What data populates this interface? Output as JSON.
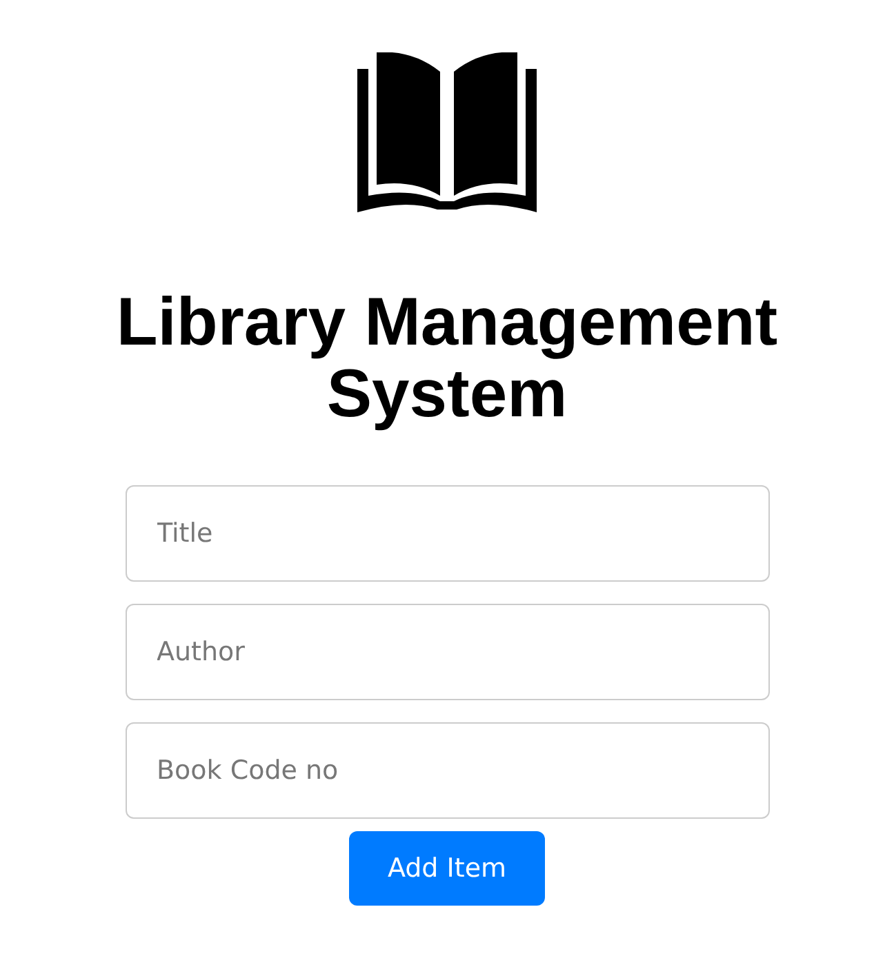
{
  "title": "Library Management System",
  "fields": [
    {
      "placeholder": "Title"
    },
    {
      "placeholder": "Author"
    },
    {
      "placeholder": "Book Code no"
    }
  ],
  "button": "Add Item"
}
